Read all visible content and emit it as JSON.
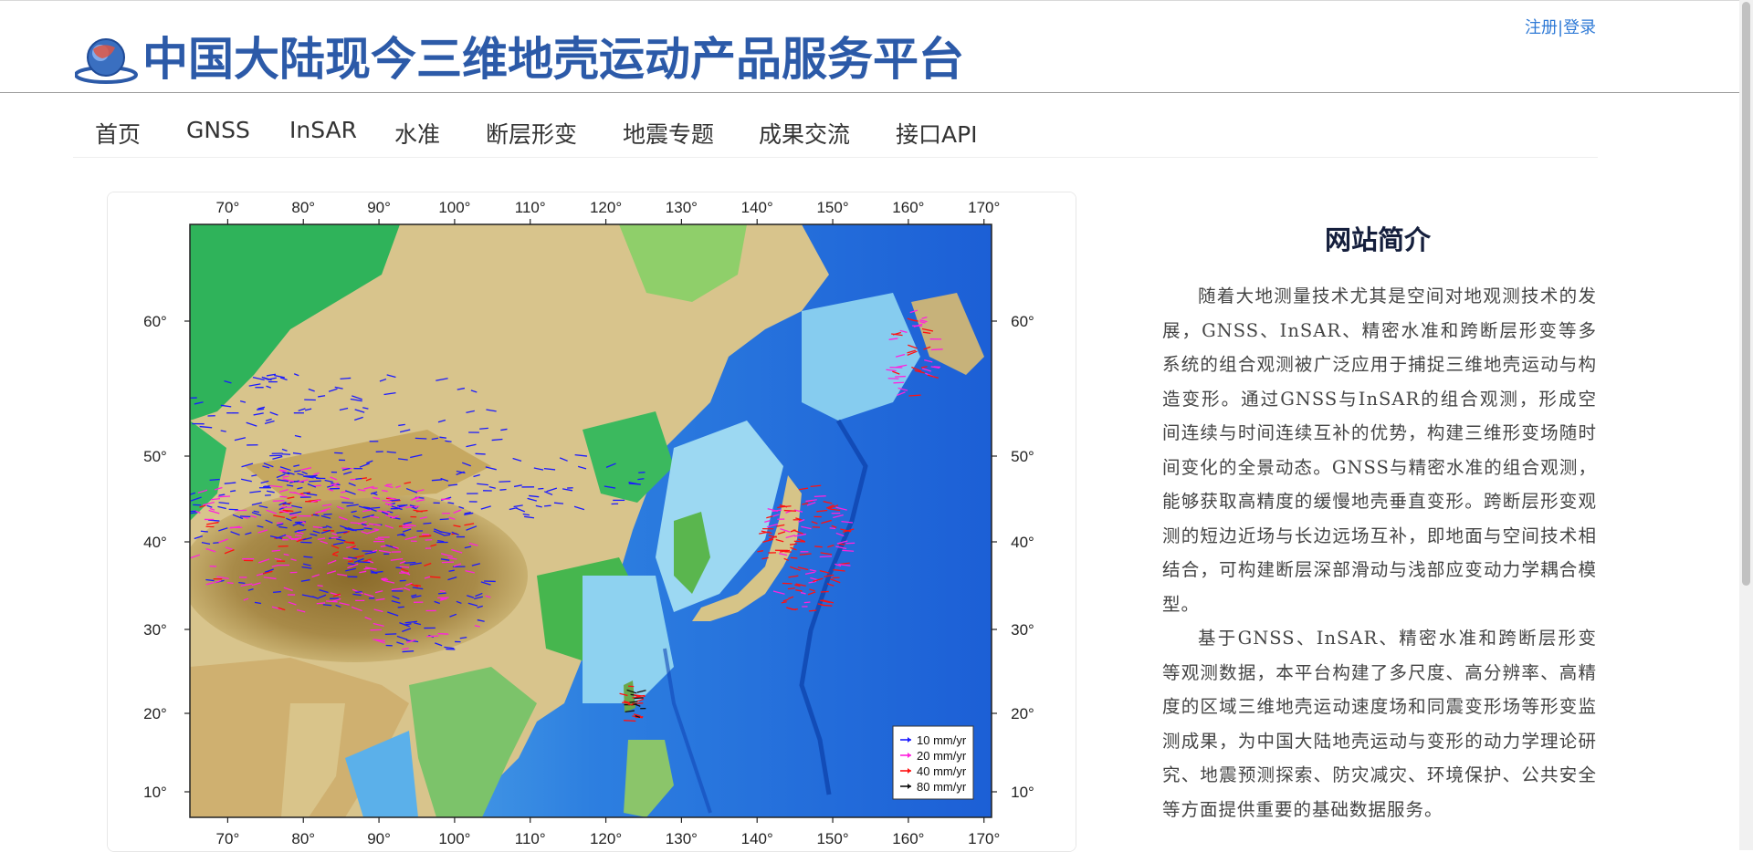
{
  "header": {
    "title": "中国大陆现今三维地壳运动产品服务平台",
    "register": "注册",
    "separator": "|",
    "login": "登录"
  },
  "nav": [
    {
      "label": "首页"
    },
    {
      "label": "GNSS"
    },
    {
      "label": "InSAR"
    },
    {
      "label": "水准"
    },
    {
      "label": "断层形变"
    },
    {
      "label": "地震专题"
    },
    {
      "label": "成果交流"
    },
    {
      "label": "接口API"
    }
  ],
  "map": {
    "lon_labels": [
      "70°",
      "80°",
      "90°",
      "100°",
      "110°",
      "120°",
      "130°",
      "140°",
      "150°",
      "160°",
      "170°"
    ],
    "lat_labels": [
      "60°",
      "50°",
      "40°",
      "30°",
      "20°",
      "10°"
    ],
    "legend": [
      {
        "label": "10 mm/yr",
        "color": "#1a1aff"
      },
      {
        "label": "20 mm/yr",
        "color": "#ff22dd"
      },
      {
        "label": "40 mm/yr",
        "color": "#ff1111"
      },
      {
        "label": "80 mm/yr",
        "color": "#111111"
      }
    ]
  },
  "intro": {
    "title": "网站简介",
    "paragraphs": [
      "随着大地测量技术尤其是空间对地观测技术的发展，GNSS、InSAR、精密水准和跨断层形变等多系统的组合观测被广泛应用于捕捉三维地壳运动与构造变形。通过GNSS与InSAR的组合观测，形成空间连续与时间连续互补的优势，构建三维形变场随时间变化的全景动态。GNSS与精密水准的组合观测，能够获取高精度的缓慢地壳垂直变形。跨断层形变观测的短边近场与长边远场互补，即地面与空间技术相结合，可构建断层深部滑动与浅部应变动力学耦合模型。",
      "基于GNSS、InSAR、精密水准和跨断层形变等观测数据，本平台构建了多尺度、高分辨率、高精度的区域三维地壳运动速度场和同震变形场等形变监测成果，为中国大陆地壳运动与变形的动力学理论研究、地震预测探索、防灾减灾、环境保护、公共安全等方面提供重要的基础数据服务。"
    ]
  },
  "colors": {
    "title": "#2c5aa8",
    "link": "#2f7ad6",
    "ocean_deep": "#1c5fd6",
    "ocean_shallow": "#9cd8f2",
    "land_low": "#2fb35a",
    "land_mid": "#d8c48c",
    "land_high": "#9a7a3a"
  }
}
